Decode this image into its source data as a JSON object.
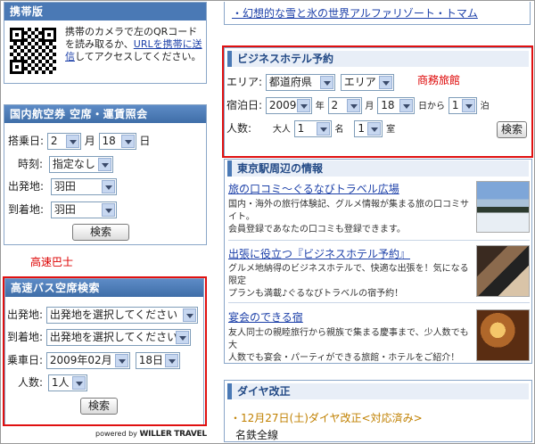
{
  "mobile": {
    "title": "携帯版",
    "text_a": "携帯のカメラで左のQRコード",
    "text_b": "を読み取るか、",
    "link": "URLを携帯に送信",
    "text_c": "してアクセスしてください。"
  },
  "flight": {
    "title": "国内航空券 空席・運賃照会",
    "date_label": "搭乗日:",
    "month": "2",
    "month_unit": "月",
    "day": "18",
    "day_unit": "日",
    "time_label": "時刻:",
    "time": "指定なし",
    "from_label": "出発地:",
    "from": "羽田",
    "to_label": "到着地:",
    "to": "羽田",
    "search": "検索"
  },
  "bus_annotation": "高速巴士",
  "bus": {
    "title": "高速バス空席検索",
    "from_label": "出発地:",
    "from": "出発地を選択してください",
    "to_label": "到着地:",
    "to": "出発地を選択してください",
    "date_label": "乗車日:",
    "month": "2009年02月",
    "day": "18日",
    "people_label": "人数:",
    "people": "1人",
    "search": "検索",
    "powered": "powered by",
    "brand": "WILLER TRAVEL"
  },
  "top_link": "・幻想的な雪と氷の世界アルファリゾート・トマム",
  "hotel": {
    "title": "ビジネスホテル予約",
    "area_label": "エリア:",
    "prefecture": "都道府県",
    "area": "エリア",
    "annotation": "商務旅館",
    "stay_label": "宿泊日:",
    "year": "2009",
    "year_unit": "年",
    "month": "2",
    "month_unit": "月",
    "day": "18",
    "day_unit": "日から",
    "nights": "1",
    "nights_unit": "泊",
    "people_label": "人数:",
    "adult_label": "大人",
    "adults": "1",
    "adults_unit": "名",
    "rooms": "1",
    "rooms_unit": "室",
    "search": "検索"
  },
  "tokyo": {
    "title": "東京駅周辺の情報",
    "items": [
      {
        "title": "旅の口コミ～ぐるなびトラベル広場",
        "desc1": "国内・海外の旅行体験記、グルメ情報が集まる旅の口コミサイト。",
        "desc2": "会員登録であなたの口コミも登録できます。"
      },
      {
        "title": "出張に役立つ『ビジネスホテル予約』",
        "desc1": "グルメ地納得のビジネスホテルで、快適な出張を！気になる限定",
        "desc2": "プランも満載♪ぐるなびトラベルの宿予約！"
      },
      {
        "title": "宴会のできる宿",
        "desc1": "友人同士の親睦旅行から親族で集まる慶事まで、少人数でも大",
        "desc2": "人数でも宴会・パーティができる旅館・ホテルをご紹介！"
      }
    ]
  },
  "diamond": {
    "title": "ダイヤ改正",
    "news": "・12月27日(土)ダイヤ改正<対応済み>",
    "line": "名鉄全線"
  }
}
